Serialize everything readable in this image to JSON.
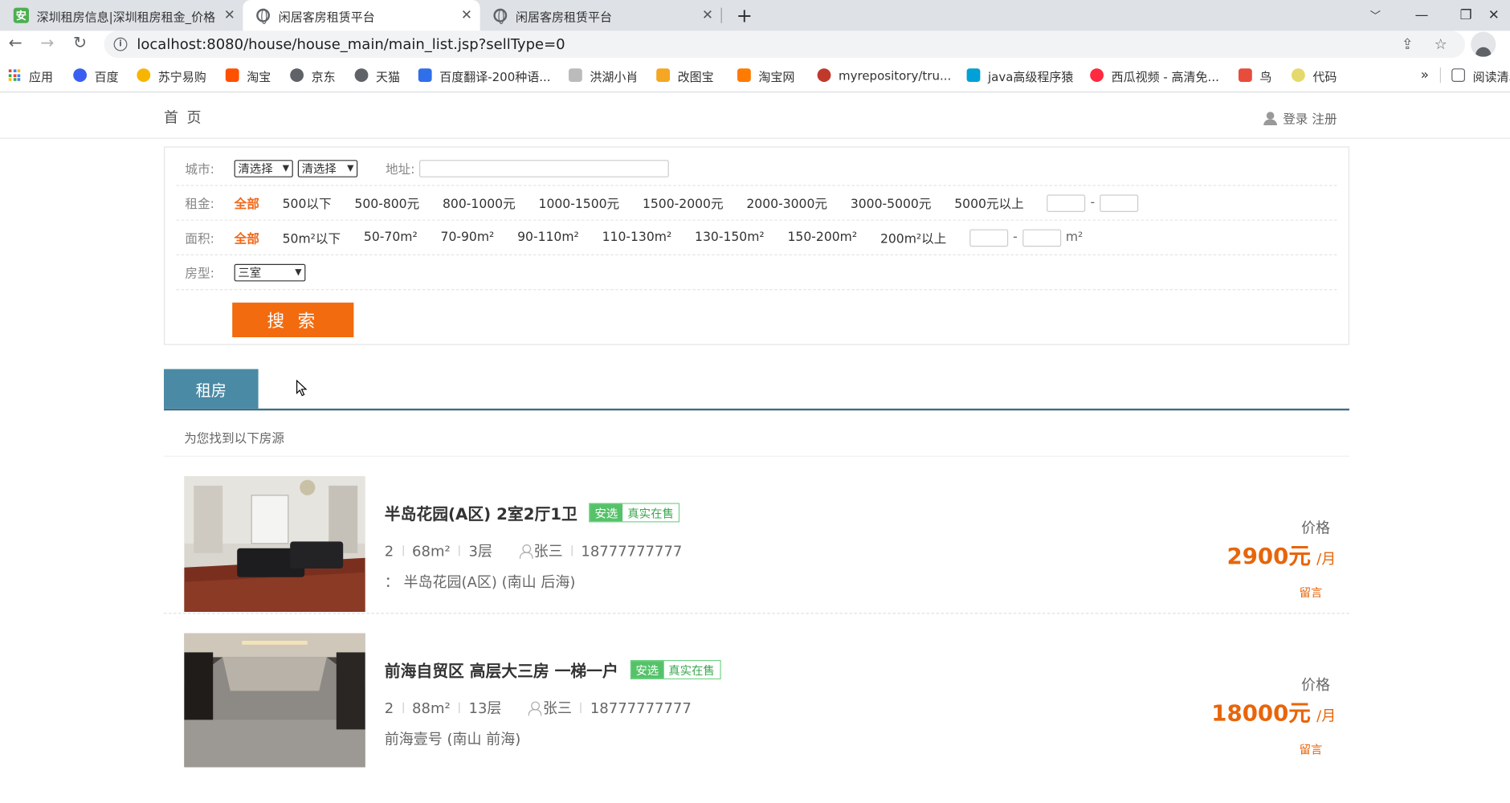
{
  "browser": {
    "tabs": [
      {
        "title": "深圳租房信息|深圳租房租金_价格",
        "favicon": "安"
      },
      {
        "title": "闲居客房租赁平台",
        "favicon": "globe"
      },
      {
        "title": "闲居客房租赁平台",
        "favicon": "globe"
      }
    ],
    "url": "localhost:8080/house/house_main/main_list.jsp?sellType=0",
    "bookmarks": [
      "应用",
      "百度",
      "苏宁易购",
      "淘宝",
      "京东",
      "天猫",
      "百度翻译-200种语...",
      "洪湖小肖",
      "改图宝",
      "淘宝网",
      "myrepository/tru...",
      "java高级程序猿",
      "西瓜视频 - 高清免...",
      "鸟",
      "代码"
    ],
    "bookmarks_overflow": "»",
    "reading_list": "阅读清单"
  },
  "nav": {
    "home": "首 页",
    "login": "登录",
    "register": "注册"
  },
  "filter": {
    "city_label": "城市:",
    "city_select_1": "清选择",
    "city_select_2": "清选择",
    "address_label": "地址:",
    "rent_label": "租金:",
    "rent_options": [
      "全部",
      "500以下",
      "500-800元",
      "800-1000元",
      "1000-1500元",
      "1500-2000元",
      "2000-3000元",
      "3000-5000元",
      "5000元以上"
    ],
    "area_label": "面积:",
    "area_options": [
      "全部",
      "50m²以下",
      "50-70m²",
      "70-90m²",
      "90-110m²",
      "110-130m²",
      "130-150m²",
      "150-200m²",
      "200m²以上"
    ],
    "range_dash": "-",
    "area_unit": "m²",
    "type_label": "房型:",
    "type_value": "三室",
    "search_button": "搜 索"
  },
  "section": {
    "tab": "租房",
    "found_text": "为您找到以下房源"
  },
  "listings": [
    {
      "title": "半岛花园(A区) 2室2厅1卫",
      "tag_a": "安选",
      "tag_b": "真实在售",
      "rooms": "2",
      "area": "68m²",
      "floor": "3层",
      "agent": "张三",
      "phone": "18777777777",
      "address": "： 半岛花园(A区) (南山 后海)",
      "price_label": "价格",
      "price": "2900元",
      "unit": "/月",
      "message": "留言"
    },
    {
      "title": "前海自贸区 高层大三房 一梯一户",
      "tag_a": "安选",
      "tag_b": "真实在售",
      "rooms": "2",
      "area": "88m²",
      "floor": "13层",
      "agent": "张三",
      "phone": "18777777777",
      "address": "前海壹号 (南山 前海)",
      "price_label": "价格",
      "price": "18000元",
      "unit": "/月",
      "message": "留言"
    }
  ]
}
